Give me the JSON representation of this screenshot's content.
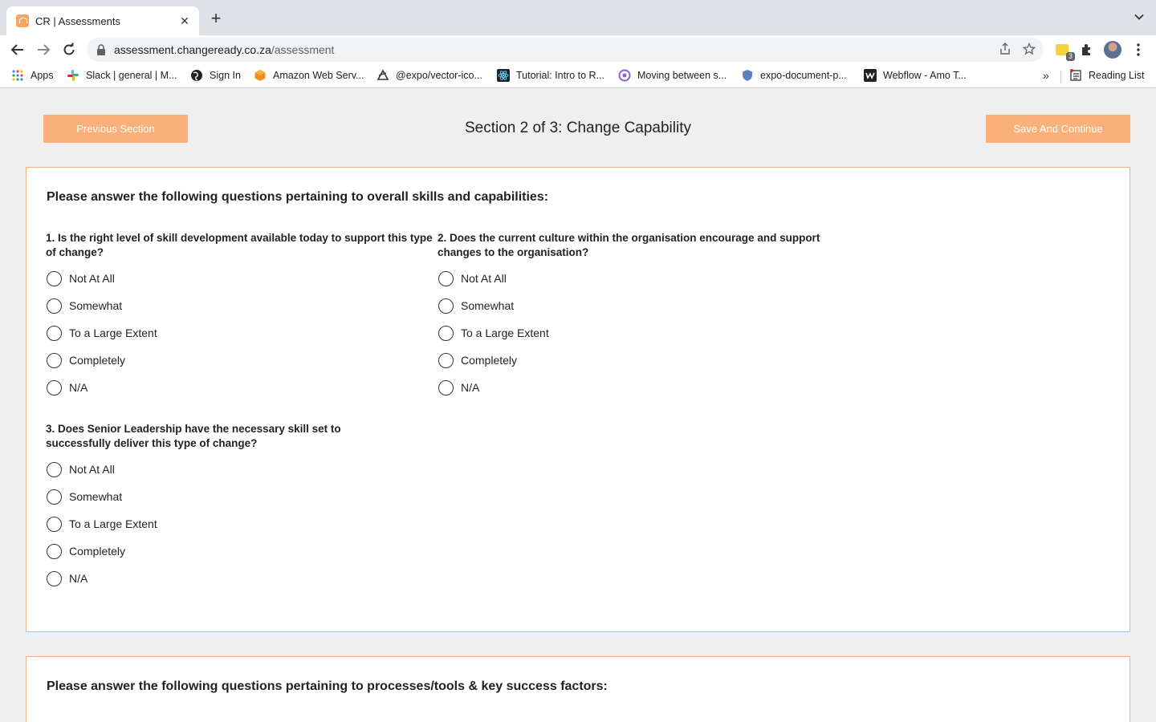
{
  "browser": {
    "tab_title": "CR | Assessments",
    "url_host": "assessment.changeready.co.za",
    "url_path": "/assessment",
    "extension_badge": "3",
    "bookmarks": [
      {
        "label": "Apps",
        "icon": "apps-grid-icon"
      },
      {
        "label": "Slack | general | M...",
        "icon": "slack-icon"
      },
      {
        "label": "Sign In",
        "icon": "globe-icon"
      },
      {
        "label": "Amazon Web Serv...",
        "icon": "aws-icon"
      },
      {
        "label": "@expo/vector-ico...",
        "icon": "expo-icon"
      },
      {
        "label": "Tutorial: Intro to R...",
        "icon": "react-icon"
      },
      {
        "label": "Moving between s...",
        "icon": "circle-icon"
      },
      {
        "label": "expo-document-p...",
        "icon": "shield-icon"
      },
      {
        "label": "Webflow - Amo T...",
        "icon": "webflow-icon"
      }
    ],
    "more_bookmarks": "»",
    "reading_list": "Reading List"
  },
  "page": {
    "prev_button": "Previous Section",
    "save_button": "Save And Continue",
    "section_title": "Section 2 of 3: Change Capability",
    "accent_color": "#fbb07a"
  },
  "card1": {
    "heading": "Please answer the following questions pertaining to overall skills and capabilities:",
    "questions": [
      {
        "text": "1. Is the right level of skill development available today to support this type of change?",
        "options": [
          "Not At All",
          "Somewhat",
          "To a Large Extent",
          "Completely",
          "N/A"
        ]
      },
      {
        "text": "2. Does the current culture within the organisation encourage and support changes to the organisation?",
        "options": [
          "Not At All",
          "Somewhat",
          "To a Large Extent",
          "Completely",
          "N/A"
        ]
      },
      {
        "text": "3. Does Senior Leadership have the necessary skill set to successfully deliver this type of change?",
        "options": [
          "Not At All",
          "Somewhat",
          "To a Large Extent",
          "Completely",
          "N/A"
        ]
      }
    ]
  },
  "card2": {
    "heading": "Please answer the following questions pertaining to processes/tools & key success factors:"
  }
}
